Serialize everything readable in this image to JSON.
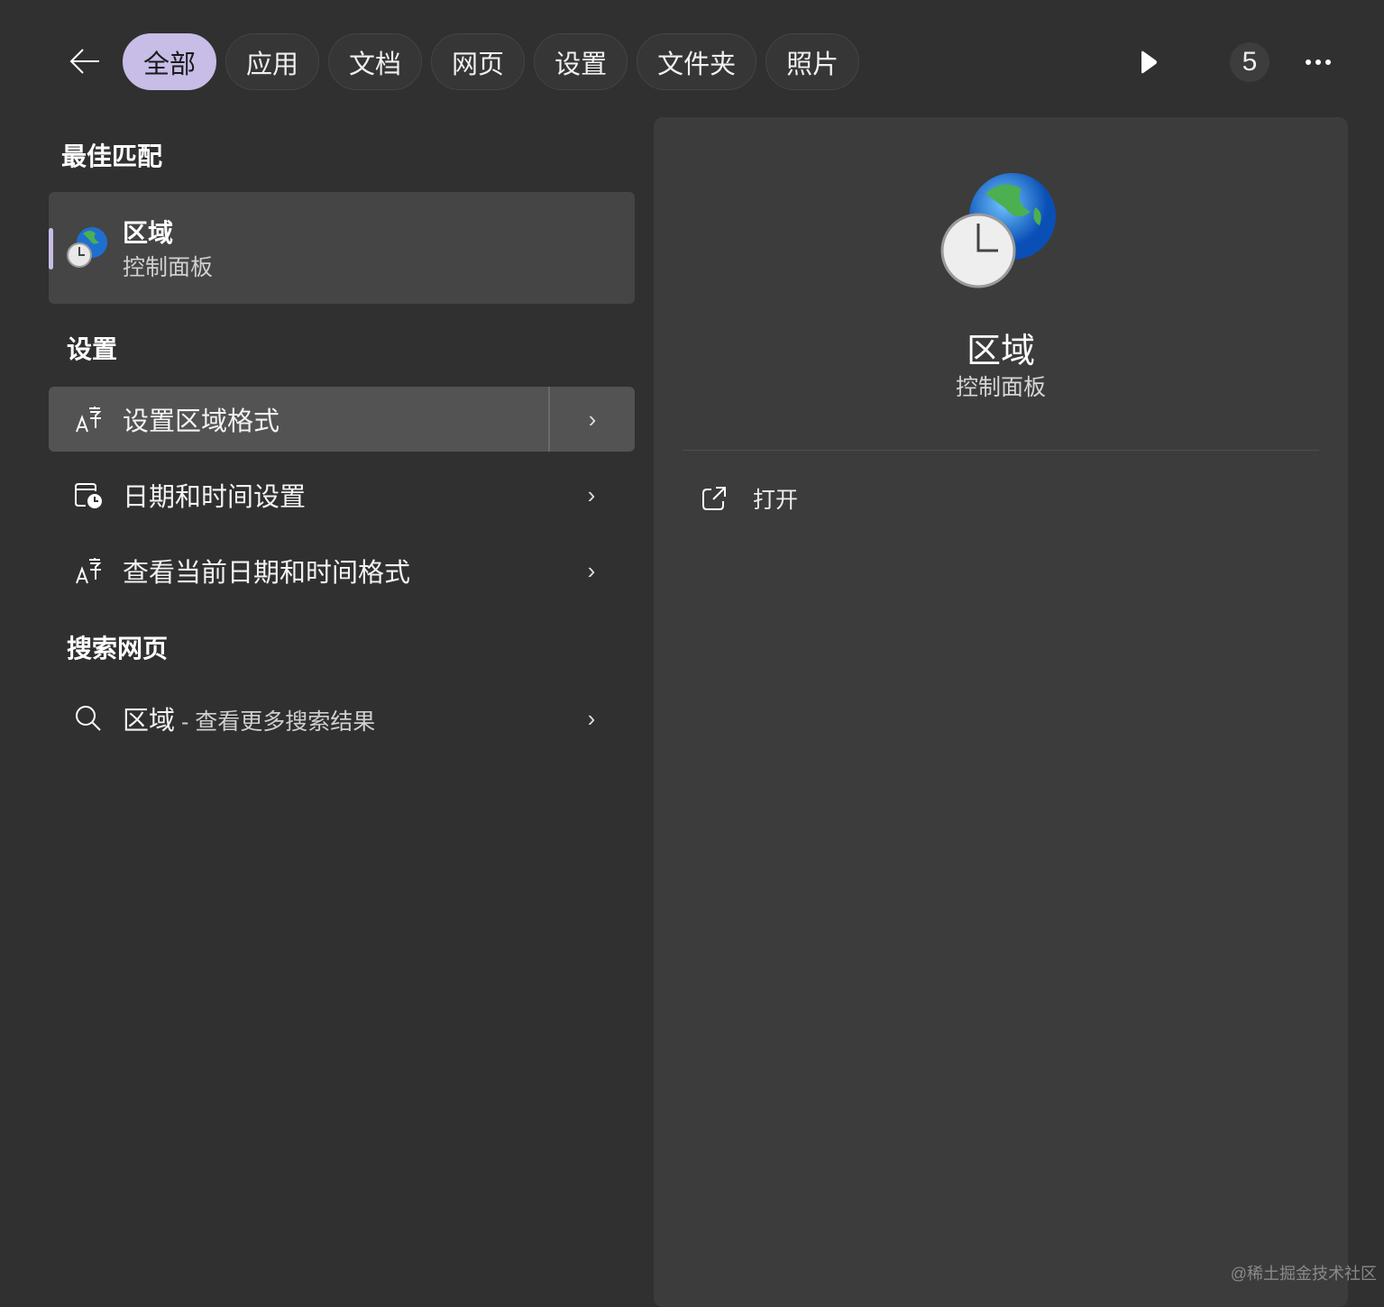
{
  "tabs": [
    "全部",
    "应用",
    "文档",
    "网页",
    "设置",
    "文件夹",
    "照片"
  ],
  "active_tab": "全部",
  "count": "5",
  "best_match": {
    "heading": "最佳匹配",
    "title": "区域",
    "subtitle": "控制面板"
  },
  "settings": {
    "heading": "设置",
    "items": [
      {
        "label": "设置区域格式"
      },
      {
        "label": "日期和时间设置"
      },
      {
        "label": "查看当前日期和时间格式"
      }
    ]
  },
  "web": {
    "heading": "搜索网页",
    "query": "区域",
    "suffix": " - 查看更多搜索结果"
  },
  "preview": {
    "title": "区域",
    "subtitle": "控制面板",
    "open_label": "打开"
  },
  "watermark": "@稀土掘金技术社区",
  "colors": {
    "accent": "#c7bde6",
    "background": "#303030",
    "panel": "#3c3c3c"
  }
}
